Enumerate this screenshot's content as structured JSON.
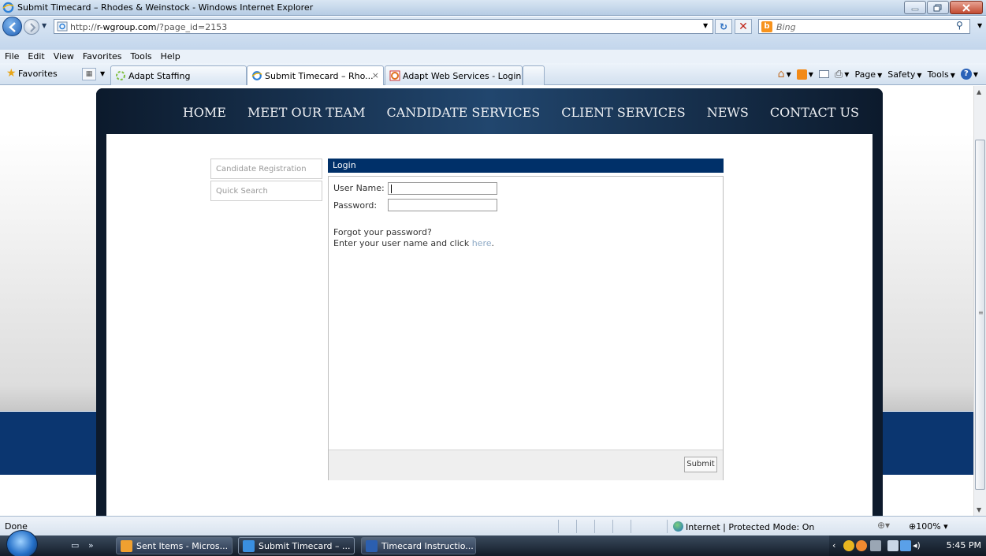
{
  "window": {
    "title": "Submit Timecard – Rhodes & Weinstock - Windows Internet Explorer"
  },
  "address": {
    "url_prefix": "http://",
    "url_host": "r-wgroup.com",
    "url_path": "/?page_id=2153",
    "search_placeholder": "Bing"
  },
  "menu": [
    "File",
    "Edit",
    "View",
    "Favorites",
    "Tools",
    "Help"
  ],
  "favorites": {
    "label": "Favorites",
    "tabs": [
      {
        "label": "Adapt Staffing",
        "active": false
      },
      {
        "label": "Submit Timecard – Rho...",
        "active": true
      },
      {
        "label": "Adapt Web Services - Login",
        "active": false
      }
    ],
    "tab_close": "×"
  },
  "commandbar": {
    "page": "Page",
    "safety": "Safety",
    "tools": "Tools"
  },
  "site": {
    "nav": [
      "HOME",
      "MEET OUR TEAM",
      "CANDIDATE SERVICES",
      "CLIENT SERVICES",
      "NEWS",
      "CONTACT US"
    ],
    "sidebar": [
      "Candidate Registration",
      "Quick Search"
    ],
    "login": {
      "header": "Login",
      "username_label": "User Name:",
      "password_label": "Password:",
      "username_value": "",
      "password_value": "",
      "forgot_line1": "Forgot your password?",
      "forgot_line2": "Enter your user name and click ",
      "forgot_link": "here",
      "forgot_end": ".",
      "submit": "Submit"
    }
  },
  "status": {
    "text": "Done",
    "zone": "Internet | Protected Mode: On",
    "zoom": "100%"
  },
  "taskbar": {
    "tasks": [
      {
        "label": "Sent Items - Micros...",
        "active": false
      },
      {
        "label": "Submit Timecard – ...",
        "active": true
      },
      {
        "label": "Timecard Instructio...",
        "active": false
      }
    ],
    "clock": "5:45 PM"
  },
  "colors": {
    "site_navy": "#003069",
    "band_blue": "#0b3670",
    "link": "#8da9c6"
  }
}
